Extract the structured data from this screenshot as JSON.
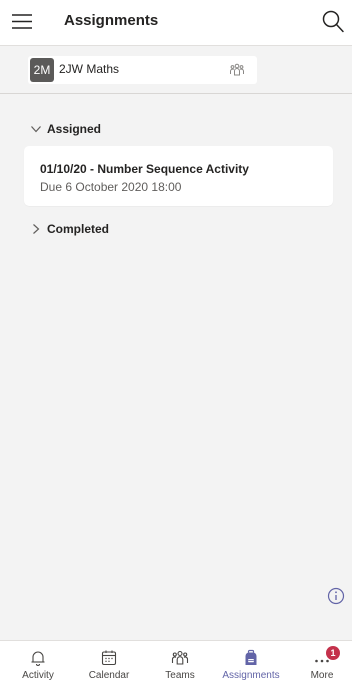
{
  "header": {
    "title": "Assignments",
    "menu_icon": "hamburger-menu-icon",
    "search_icon": "search-icon"
  },
  "team": {
    "avatar_initials": "2M",
    "name": "2JW Maths",
    "switch_icon": "teams-people-icon"
  },
  "sections": {
    "assigned_label": "Assigned",
    "completed_label": "Completed"
  },
  "assignments": [
    {
      "title": "01/10/20 - Number Sequence Activity",
      "due": "Due 6 October 2020 18:00"
    }
  ],
  "info_icon": "info-icon",
  "nav": {
    "items": [
      {
        "label": "Activity",
        "icon": "bell-icon"
      },
      {
        "label": "Calendar",
        "icon": "calendar-icon"
      },
      {
        "label": "Teams",
        "icon": "teams-icon"
      },
      {
        "label": "Assignments",
        "icon": "backpack-icon",
        "active": true
      },
      {
        "label": "More",
        "icon": "more-dots-icon",
        "badge": "1"
      }
    ]
  },
  "colors": {
    "accent": "#6264a7",
    "badge": "#c4314b",
    "background": "#f3f3f3"
  }
}
